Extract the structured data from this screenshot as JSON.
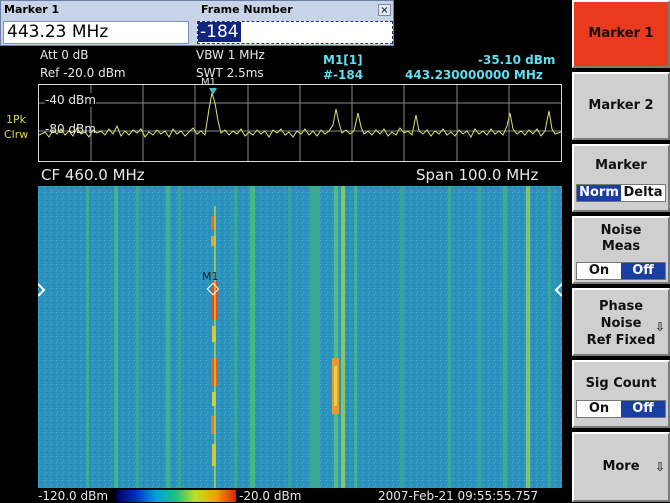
{
  "dialog": {
    "left_title": "Marker 1",
    "right_title": "Frame Number",
    "close_symbol": "×",
    "marker_value": "443.23 MHz",
    "frame_value": "-184"
  },
  "header": {
    "att": "Att  0 dB",
    "ref": "Ref  -20.0 dBm",
    "vbw": "VBW 1 MHz",
    "swt": "SWT 2.5ms",
    "marker_label": "M1[1]",
    "marker_frame": "#-184",
    "marker_level": "-35.10 dBm",
    "marker_freq": "443.230000000 MHz"
  },
  "trace": {
    "detector": "1Pk",
    "mode": "Clrw",
    "level_top": "-40 dBm",
    "level_mid": "-80 dBm",
    "marker_tag": "M1"
  },
  "freq": {
    "cf": "CF 460.0 MHz",
    "span": "Span 100.0 MHz"
  },
  "spectrogram": {
    "marker_tag": "M1"
  },
  "footer": {
    "scale_min": "-120.0 dBm",
    "scale_max": "-20.0 dBm",
    "timestamp": "2007-Feb-21  09:55:55.757"
  },
  "softkeys": {
    "marker1": "Marker 1",
    "marker2": "Marker 2",
    "marker": "Marker",
    "norm": "Norm",
    "delta": "Delta",
    "noise_line1": "Noise",
    "noise_line2": "Meas",
    "on": "On",
    "off": "Off",
    "phase_line1": "Phase",
    "phase_line2": "Noise",
    "phase_line3": "Ref Fixed",
    "sig_count": "Sig Count",
    "more": "More"
  },
  "colors": {
    "active_softkey": "#ea3b1f",
    "toggle_active": "#1b3fa0",
    "annotation": "#5fe0f0",
    "trace": "#e0e070",
    "spectrogram_bg": "#2a8fb8"
  }
}
